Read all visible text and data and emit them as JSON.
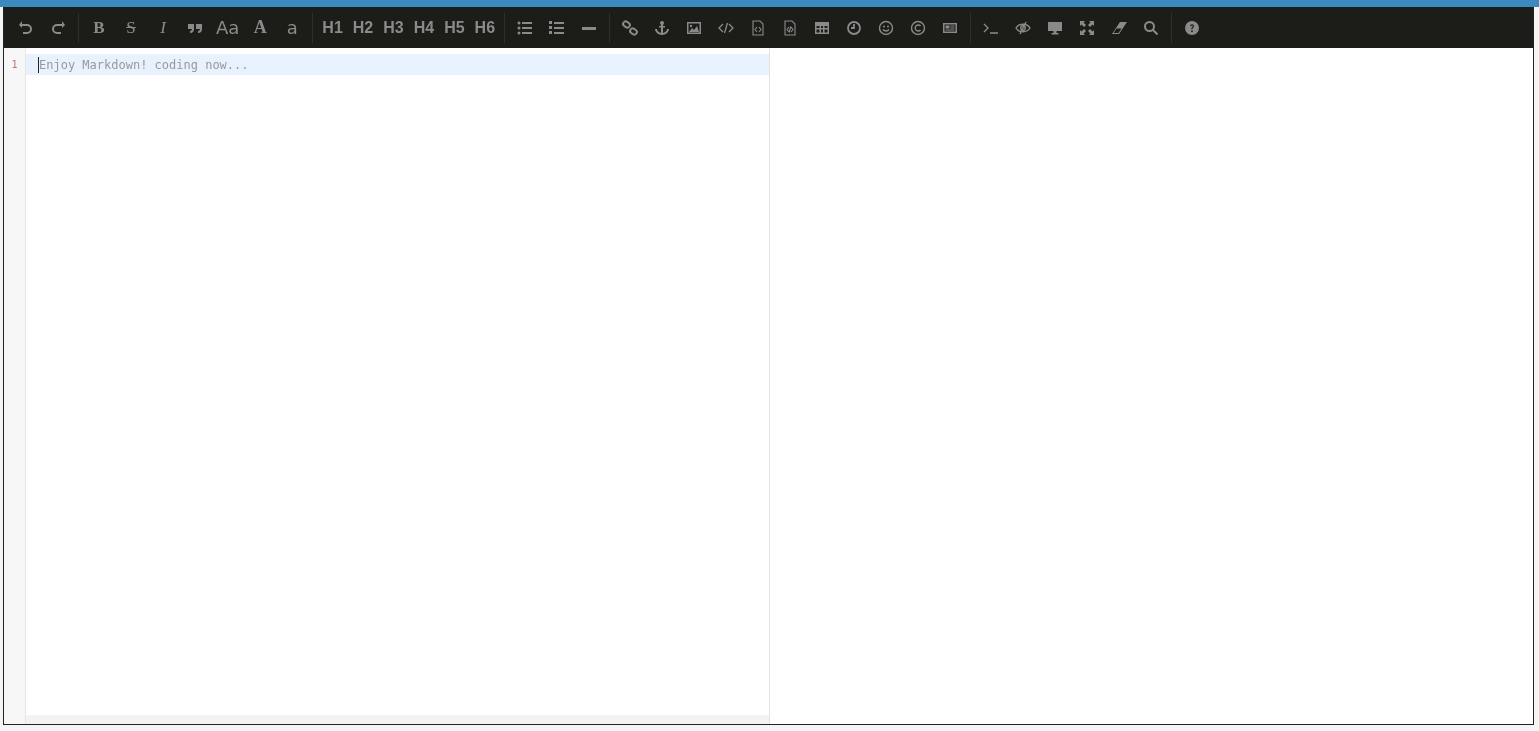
{
  "toolbar": {
    "groups": [
      {
        "items": [
          {
            "kind": "icon"
          },
          {
            "kind": "icon"
          }
        ]
      },
      {
        "items": [
          {
            "kind": "text",
            "label": "B"
          },
          {
            "kind": "text",
            "label": "S"
          },
          {
            "kind": "text",
            "label": "I"
          },
          {
            "kind": "icon"
          },
          {
            "kind": "text",
            "label": "Aa"
          },
          {
            "kind": "text",
            "label": "A"
          },
          {
            "kind": "text",
            "label": "a"
          }
        ]
      },
      {
        "items": [
          {
            "kind": "text",
            "label": "H1"
          },
          {
            "kind": "text",
            "label": "H2"
          },
          {
            "kind": "text",
            "label": "H3"
          },
          {
            "kind": "text",
            "label": "H4"
          },
          {
            "kind": "text",
            "label": "H5"
          },
          {
            "kind": "text",
            "label": "H6"
          }
        ]
      },
      {
        "items": [
          {
            "kind": "icon"
          },
          {
            "kind": "icon"
          },
          {
            "kind": "icon"
          }
        ]
      },
      {
        "items": [
          {
            "kind": "icon"
          },
          {
            "kind": "icon"
          },
          {
            "kind": "icon"
          },
          {
            "kind": "icon"
          },
          {
            "kind": "icon"
          },
          {
            "kind": "icon"
          },
          {
            "kind": "icon"
          },
          {
            "kind": "icon"
          },
          {
            "kind": "icon"
          },
          {
            "kind": "icon"
          },
          {
            "kind": "icon"
          }
        ]
      },
      {
        "items": [
          {
            "kind": "icon"
          },
          {
            "kind": "icon"
          },
          {
            "kind": "icon"
          },
          {
            "kind": "icon"
          },
          {
            "kind": "icon"
          },
          {
            "kind": "icon"
          }
        ]
      },
      {
        "items": [
          {
            "kind": "icon"
          }
        ]
      }
    ]
  },
  "editor": {
    "lines": [
      {
        "number": "1",
        "placeholder": "Enjoy Markdown! coding now...",
        "active": true
      }
    ]
  }
}
